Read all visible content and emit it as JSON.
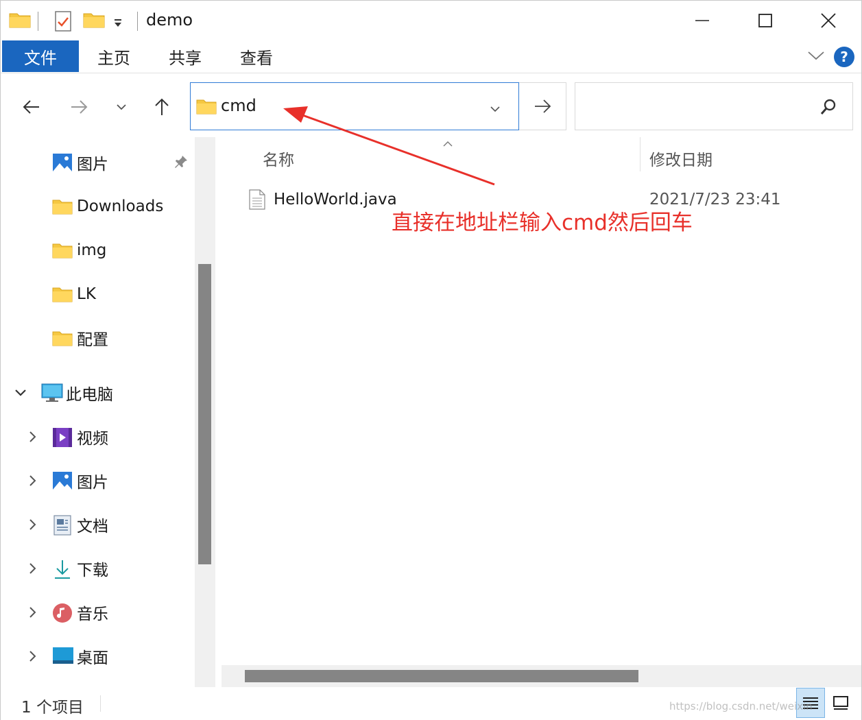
{
  "window": {
    "title": "demo",
    "controls": {
      "minimize": "minimize",
      "maximize": "maximize",
      "close": "close"
    }
  },
  "ribbon": {
    "tabs": [
      {
        "label": "文件",
        "active": true
      },
      {
        "label": "主页"
      },
      {
        "label": "共享"
      },
      {
        "label": "查看"
      }
    ],
    "help": "?"
  },
  "nav": {
    "address_value": "cmd"
  },
  "sidebar": {
    "quick_access": [
      {
        "label": "图片",
        "icon": "pictures-icon",
        "pinned": true
      },
      {
        "label": "Downloads",
        "icon": "folder-icon"
      },
      {
        "label": "img",
        "icon": "folder-icon"
      },
      {
        "label": "LK",
        "icon": "folder-icon"
      },
      {
        "label": "配置",
        "icon": "folder-icon"
      }
    ],
    "this_pc": {
      "label": "此电脑",
      "icon": "computer-icon",
      "expanded": true
    },
    "pc_items": [
      {
        "label": "视频",
        "icon": "videos-icon"
      },
      {
        "label": "图片",
        "icon": "pictures-icon"
      },
      {
        "label": "文档",
        "icon": "documents-icon"
      },
      {
        "label": "下载",
        "icon": "download-icon"
      },
      {
        "label": "音乐",
        "icon": "music-icon"
      },
      {
        "label": "桌面",
        "icon": "desktop-icon"
      }
    ]
  },
  "content": {
    "columns": {
      "name": "名称",
      "date": "修改日期"
    },
    "files": [
      {
        "name": "HelloWorld.java",
        "date": "2021/7/23 23:41"
      }
    ]
  },
  "status": {
    "item_count": "1 个项目",
    "watermark": "https://blog.csdn.net/weixin"
  },
  "annotation": {
    "text": "直接在地址栏输入cmd然后回车",
    "color": "#e8302a"
  },
  "colors": {
    "accent": "#1a66bf",
    "address_border": "#2f7bd6",
    "folder": "#f5c842"
  }
}
